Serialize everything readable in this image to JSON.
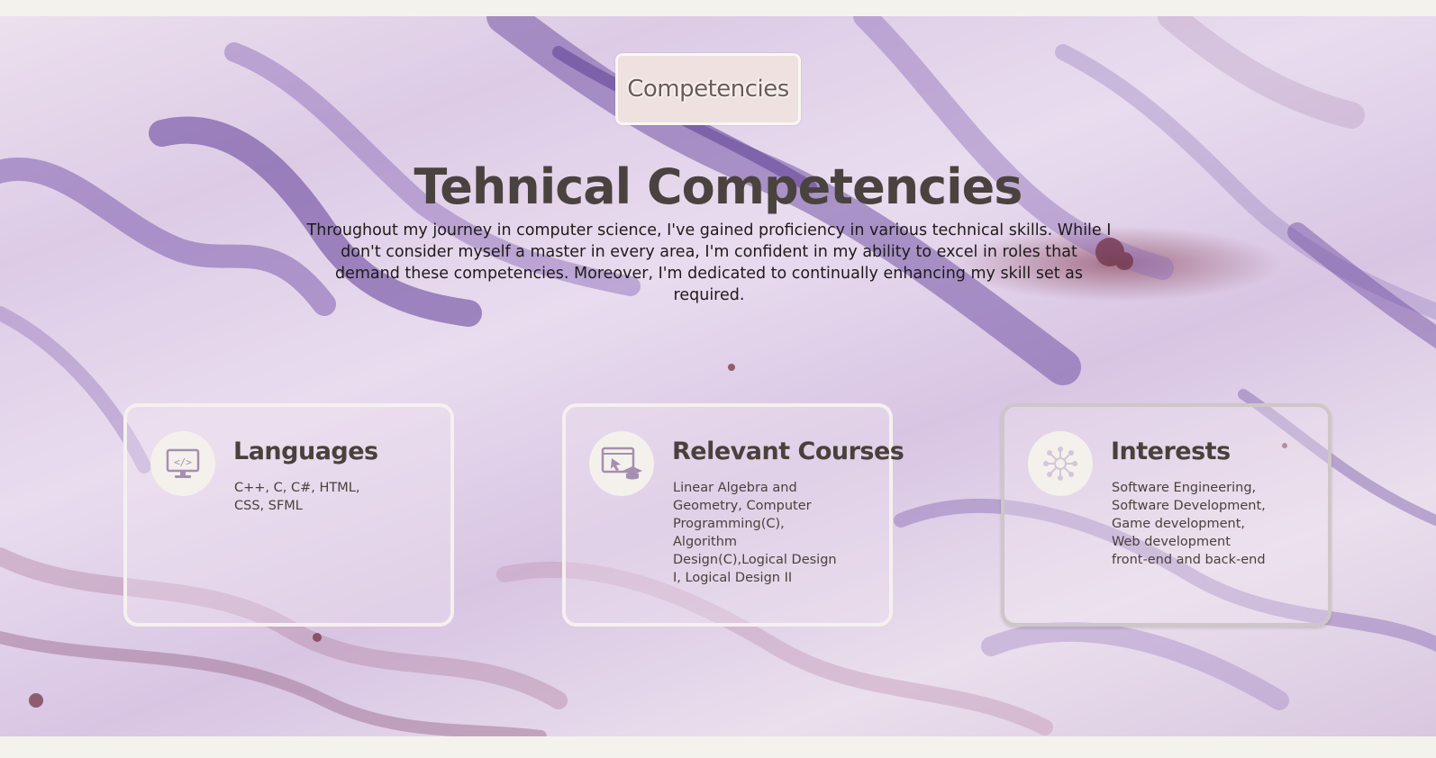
{
  "badge": {
    "label": "Competencies"
  },
  "heading": {
    "title": "Tehnical Competencies",
    "intro": "Throughout my journey in computer science, I've gained proficiency in various technical skills. While I don't consider myself a master in every area, I'm confident in my ability to excel in roles that demand these competencies. Moreover, I'm dedicated to continually enhancing my skill set as required."
  },
  "cards": [
    {
      "icon": "code-monitor-icon",
      "title": "Languages",
      "text": "C++, C, C#, HTML, CSS, SFML"
    },
    {
      "icon": "online-course-icon",
      "title": "Relevant Courses",
      "text": "Linear Algebra and Geometry, Computer Programming(C), Algorithm Design(C),Logical Design I, Logical Design II"
    },
    {
      "icon": "network-hub-icon",
      "title": "Interests",
      "text": "Software Engineering, Software Development, Game development, Web development front-end and back-end"
    }
  ],
  "colors": {
    "page_background": "#f4f2ed",
    "marble_purple": "#7a5aa8",
    "marble_light": "#e9dcef",
    "heading_text": "#4a423e",
    "badge_background": "#efe1e0",
    "icon_circle": "#f4f1ec"
  }
}
